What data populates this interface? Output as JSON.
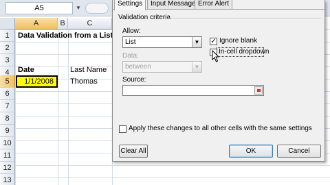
{
  "namebox": {
    "value": "A5"
  },
  "columns": [
    "A",
    "B",
    "C"
  ],
  "rows": [
    "1",
    "2",
    "3",
    "4",
    "5",
    "6",
    "7",
    "8",
    "9",
    "10",
    "11",
    "12",
    "13",
    "14"
  ],
  "cells": {
    "a1": "Data Validation from a List",
    "a4": "Date",
    "c4": "Last Name",
    "a5": "1/1/2008",
    "c5": "Thomas"
  },
  "dialog": {
    "tabs": [
      "Settings",
      "Input Message",
      "Error Alert"
    ],
    "section_label": "Validation criteria",
    "allow_label": "Allow:",
    "allow_value": "List",
    "ignore_blank_label": "Ignore blank",
    "incell_dropdown_label": "In-cell dropdown",
    "data_label": "Data:",
    "data_value": "between",
    "source_label": "Source:",
    "source_value": "",
    "apply_all_label": "Apply these changes to all other cells with the same settings",
    "clear_all_label": "Clear All",
    "ok_label": "OK",
    "cancel_label": "Cancel",
    "ignore_blank_checked": true,
    "incell_dropdown_checked": false,
    "apply_all_checked": false
  }
}
